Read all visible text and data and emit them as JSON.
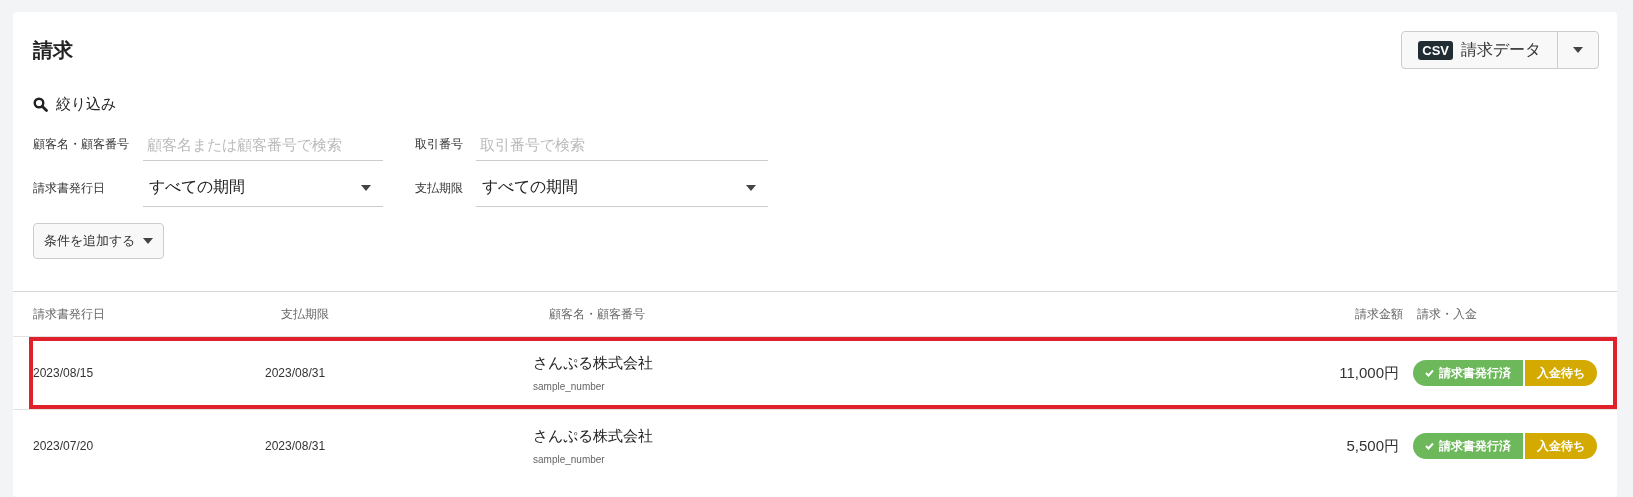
{
  "page": {
    "title": "請求"
  },
  "export_button": {
    "badge": "CSV",
    "label": "請求データ"
  },
  "filter": {
    "heading": "絞り込み",
    "fields": [
      {
        "kind": "text",
        "label": "顧客名・顧客番号",
        "placeholder": "顧客名または顧客番号で検索"
      },
      {
        "kind": "text",
        "label": "取引番号",
        "placeholder": "取引番号で検索"
      },
      {
        "kind": "select",
        "label": "請求書発行日",
        "value": "すべての期間"
      },
      {
        "kind": "select",
        "label": "支払期限",
        "value": "すべての期間"
      }
    ],
    "add_button": "条件を追加する"
  },
  "table": {
    "columns": [
      "請求書発行日",
      "支払期限",
      "顧客名・顧客番号",
      "請求金額",
      "請求・入金"
    ],
    "rows": [
      {
        "highlighted": true,
        "issue_date": "2023/08/15",
        "due_date": "2023/08/31",
        "customer": "さんぷる株式会社",
        "customer_number": "sample_number",
        "amount": "11,000円",
        "statuses": [
          {
            "label": "請求書発行済",
            "checked": true,
            "color": "#6cb85a"
          },
          {
            "label": "入金待ち",
            "checked": false,
            "color": "#d4aa00"
          }
        ]
      },
      {
        "highlighted": false,
        "issue_date": "2023/07/20",
        "due_date": "2023/08/31",
        "customer": "さんぷる株式会社",
        "customer_number": "sample_number",
        "amount": "5,500円",
        "statuses": [
          {
            "label": "請求書発行済",
            "checked": true,
            "color": "#6cb85a"
          },
          {
            "label": "入金待ち",
            "checked": false,
            "color": "#d4aa00"
          }
        ]
      }
    ]
  }
}
